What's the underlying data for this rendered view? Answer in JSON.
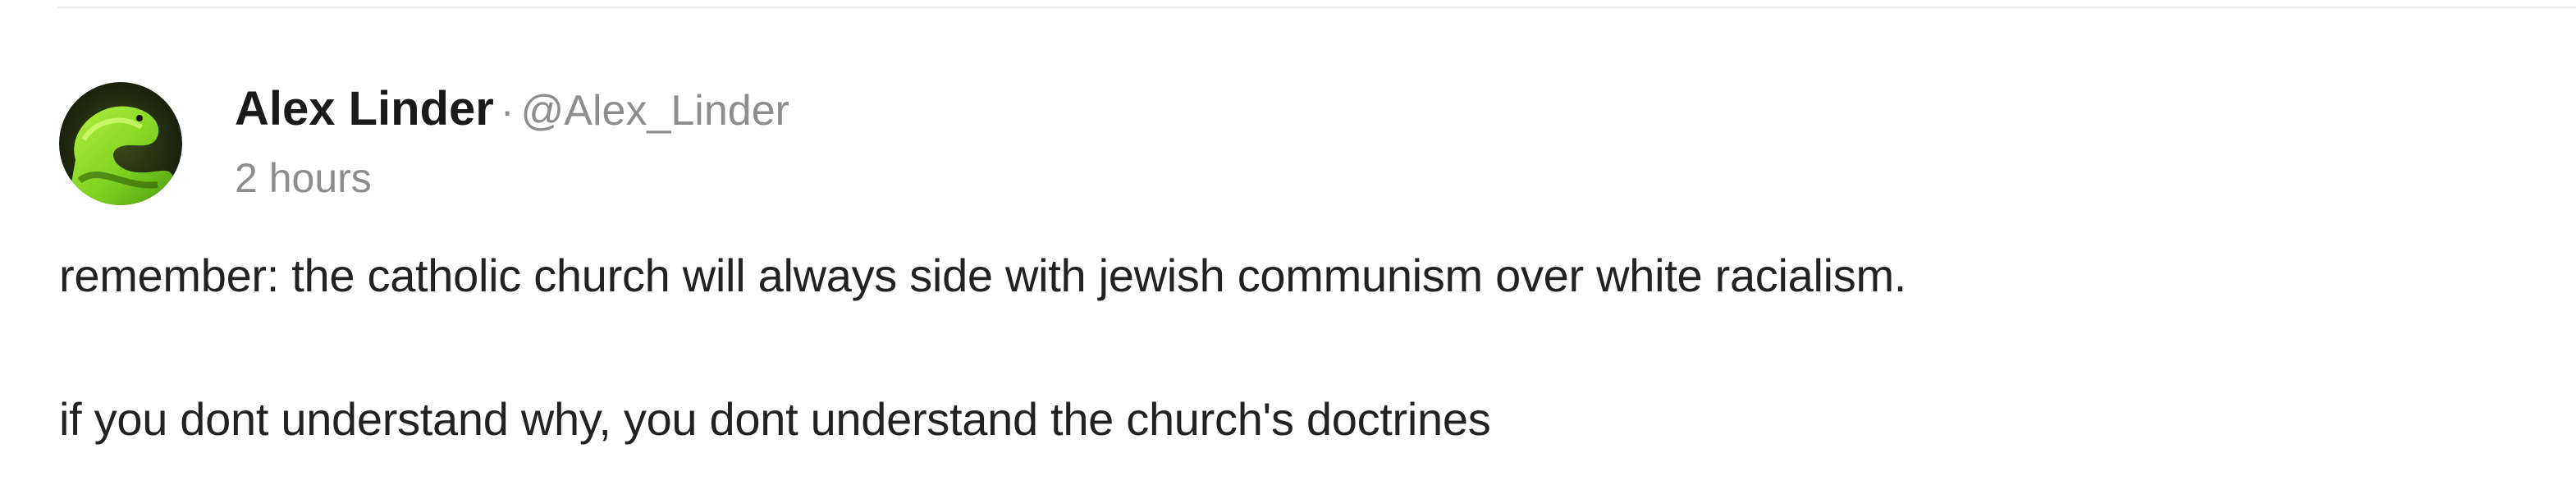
{
  "post": {
    "author_name": "Alex Linder",
    "separator": "·",
    "author_handle": "@Alex_Linder",
    "timestamp": "2 hours",
    "body_lines": [
      "remember: the catholic church will always side with jewish communism over white racialism.",
      "if you dont understand why, you dont understand the church's doctrines"
    ]
  },
  "colors": {
    "name": "#1a1a1a",
    "muted": "#8d8d8d",
    "body": "#222222",
    "divider": "#e6e8eb",
    "avatar_green": "#7cd11f",
    "avatar_dark": "#1f2a12"
  },
  "icons": {
    "avatar": "avatar-green-snake-image"
  }
}
